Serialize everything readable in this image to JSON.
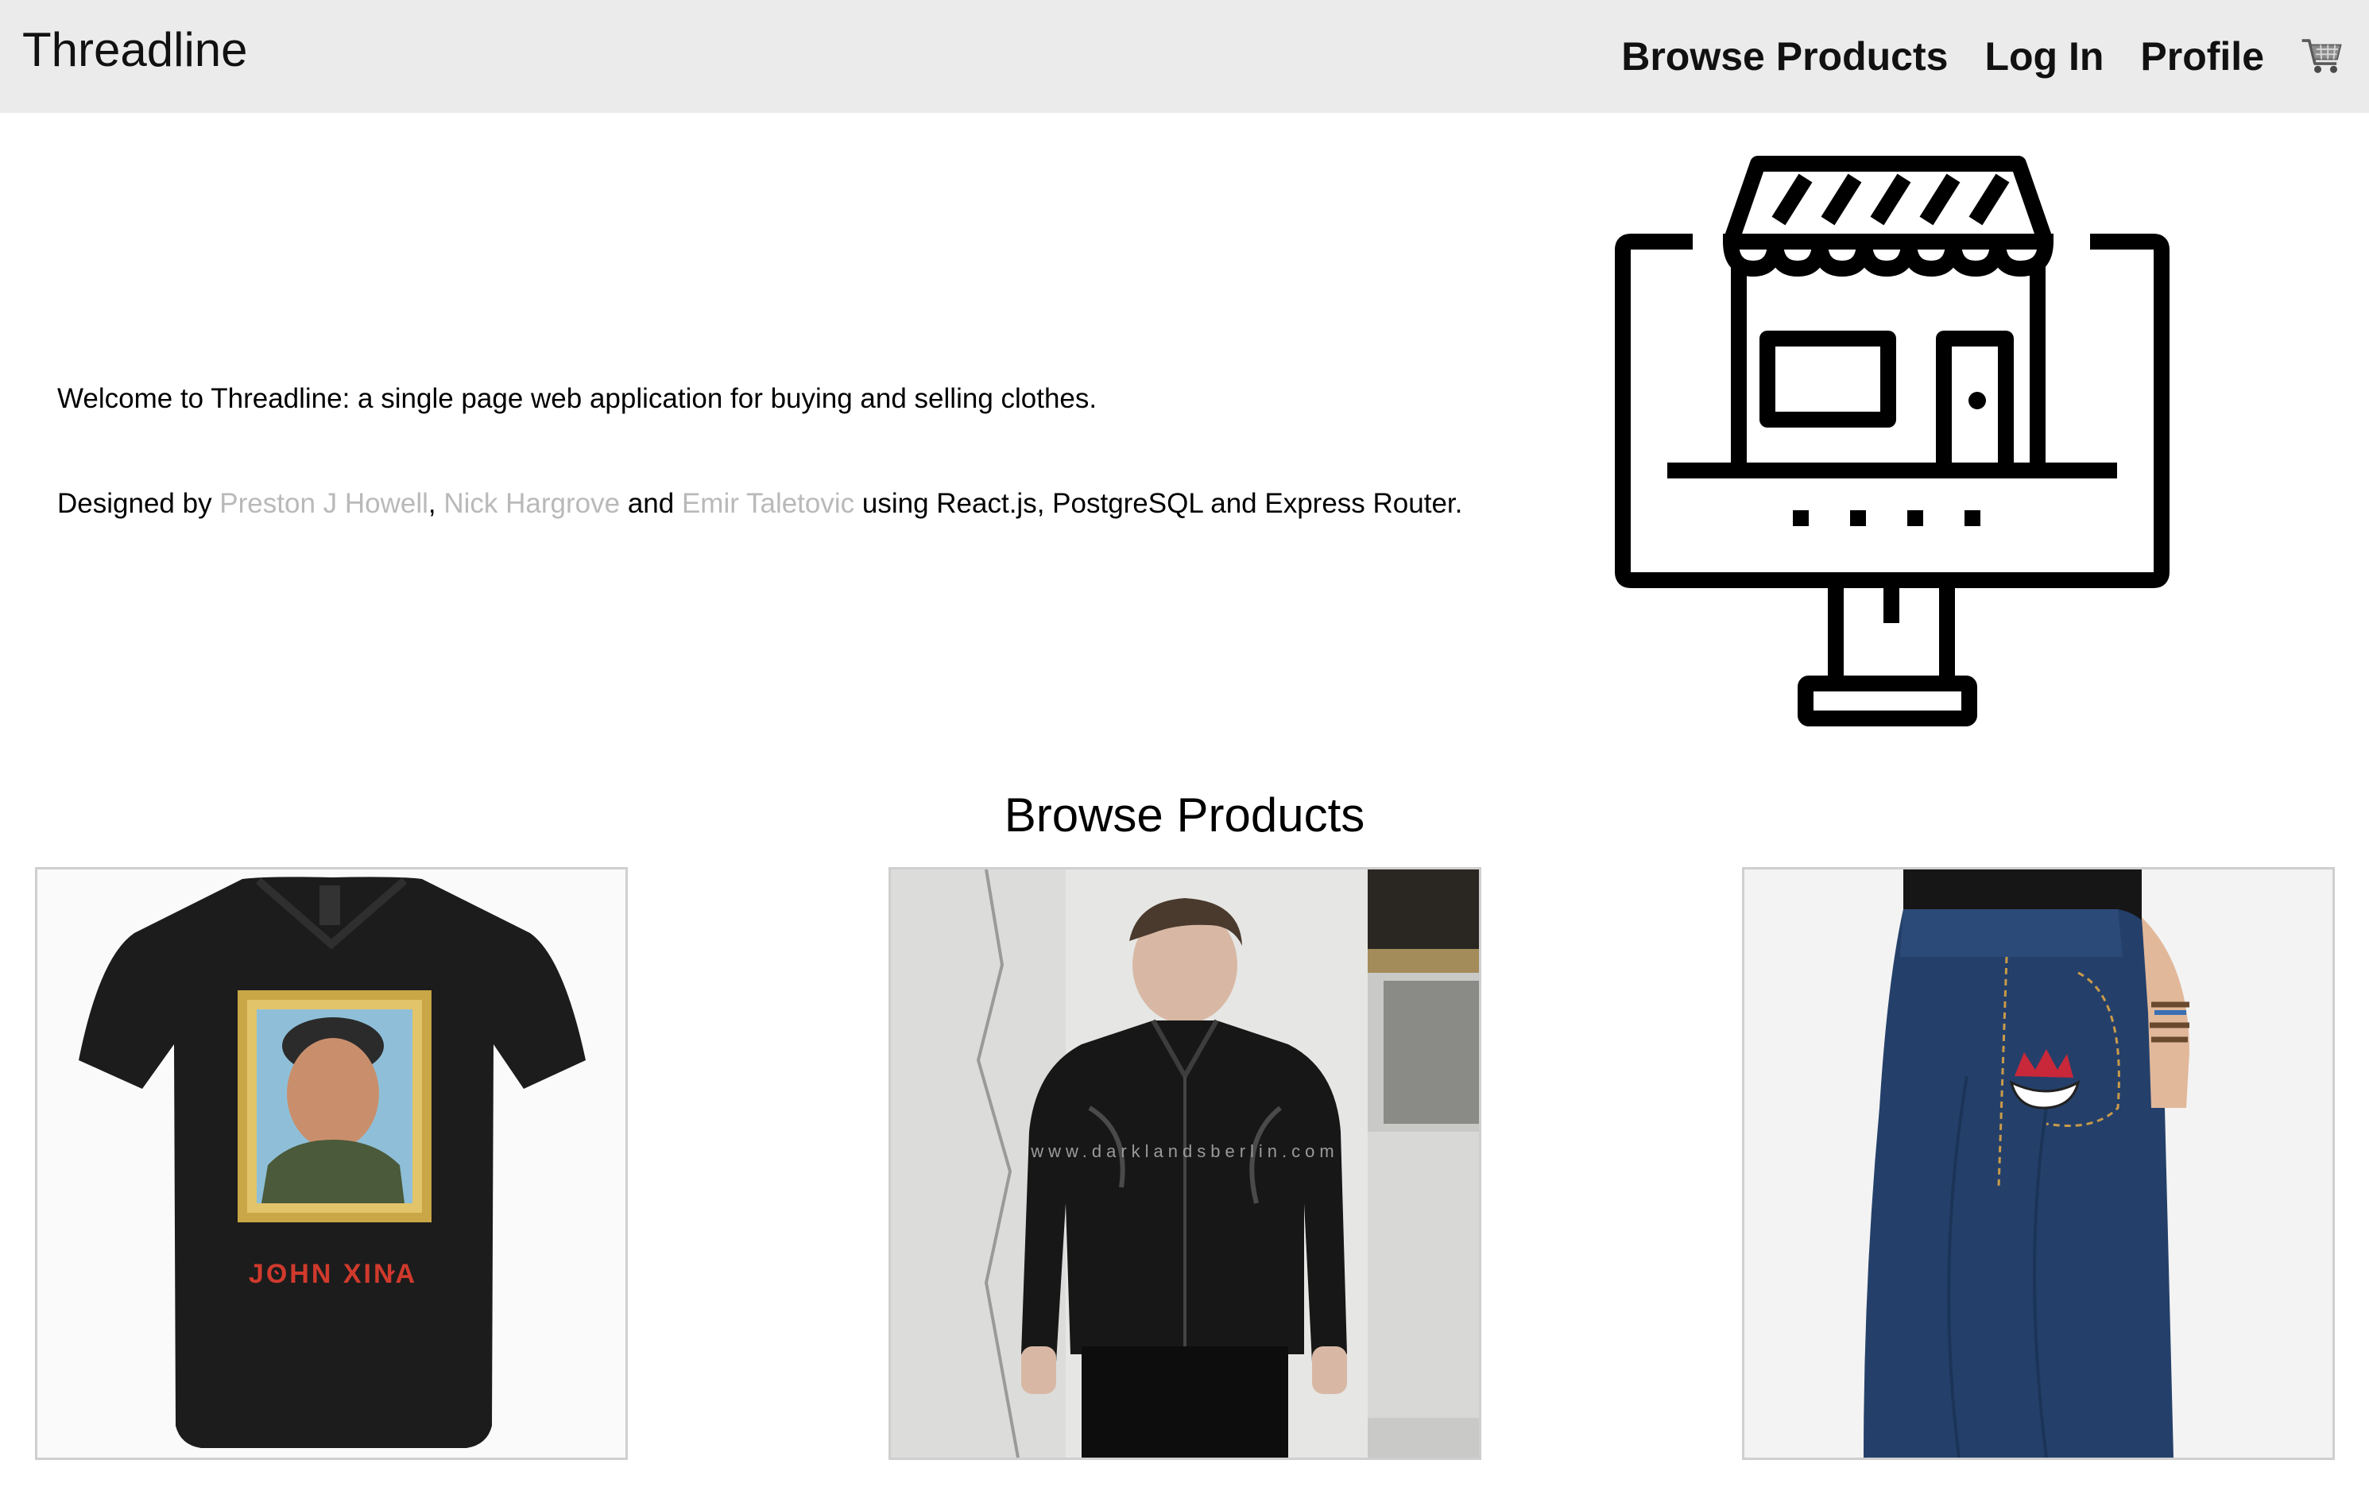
{
  "app": {
    "brand": "Threadline"
  },
  "nav": {
    "items": [
      {
        "label": "Browse Products"
      },
      {
        "label": "Log In"
      },
      {
        "label": "Profile"
      }
    ],
    "cart_icon": "shopping-cart-icon"
  },
  "intro": {
    "welcome": "Welcome to Threadline: a single page web application for buying and selling clothes.",
    "designed_prefix": "Designed by ",
    "authors": [
      "Preston J Howell",
      "Nick Hargrove",
      "Emir Taletovic"
    ],
    "sep_comma": ", ",
    "sep_and": " and ",
    "designed_suffix": " using React.js, PostgreSQL and Express Router."
  },
  "illustration": {
    "icon": "online-store-icon"
  },
  "browse": {
    "title": "Browse Products",
    "products": [
      {
        "image": "black-vneck-tshirt-image",
        "print_text": "JOHN XINA"
      },
      {
        "image": "leather-jacket-model-image",
        "watermark": "www.darklandsberlin.com"
      },
      {
        "image": "baggy-jeans-image"
      }
    ]
  },
  "colors": {
    "navbar_bg": "#ebebeb",
    "link_muted": "#b9b9b9",
    "card_border": "#cfcfcf"
  }
}
